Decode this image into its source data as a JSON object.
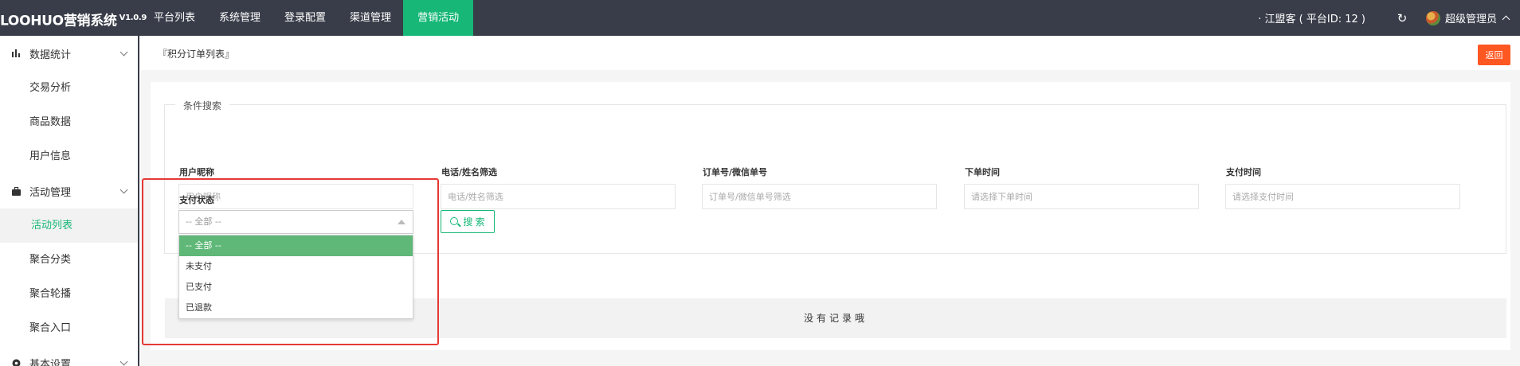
{
  "header": {
    "brand": "LOOHUO营销系统",
    "version": "V1.0.9",
    "tabs": [
      {
        "label": "平台列表"
      },
      {
        "label": "系统管理"
      },
      {
        "label": "登录配置"
      },
      {
        "label": "渠道管理"
      },
      {
        "label": "营销活动"
      }
    ],
    "active_tab": "营销活动",
    "station": "· 江盟客 ( 平台ID: 12 )",
    "refresh_icon": "refresh-icon",
    "user": "超级管理员"
  },
  "sidebar": {
    "groups": [
      {
        "label": "数据统计",
        "icon": "bar-chart-icon",
        "items": [
          {
            "label": "交易分析"
          },
          {
            "label": "商品数据"
          },
          {
            "label": "用户信息"
          }
        ]
      },
      {
        "label": "活动管理",
        "icon": "briefcase-icon",
        "items": [
          {
            "label": "活动列表"
          },
          {
            "label": "聚合分类"
          },
          {
            "label": "聚合轮播"
          },
          {
            "label": "聚合入口"
          }
        ]
      },
      {
        "label": "基本设置",
        "icon": "settings-icon",
        "items": []
      }
    ],
    "active_item": "活动列表"
  },
  "page": {
    "breadcrumb": "『积分订单列表』",
    "back_label": "返回"
  },
  "search": {
    "legend": "条件搜索",
    "fields": [
      {
        "label": "用户昵称",
        "placeholder": "用户昵称"
      },
      {
        "label": "电话/姓名筛选",
        "placeholder": "电话/姓名筛选"
      },
      {
        "label": "订单号/微信单号",
        "placeholder": "订单号/微信单号筛选"
      },
      {
        "label": "下单时间",
        "placeholder": "请选择下单时间"
      },
      {
        "label": "支付时间",
        "placeholder": "请选择支付时间"
      }
    ],
    "status_label": "支付状态",
    "status_value": "-- 全部 --",
    "status_options": [
      "-- 全部 --",
      "未支付",
      "已支付",
      "已退款"
    ],
    "search_button": "搜 索"
  },
  "table": {
    "empty_text": "没有记录哦"
  },
  "colors": {
    "topbar": "#393d49",
    "accent": "#16b777",
    "selected_option": "#5fb878",
    "back_button": "#ff5722",
    "highlight_box": "#e53935"
  }
}
